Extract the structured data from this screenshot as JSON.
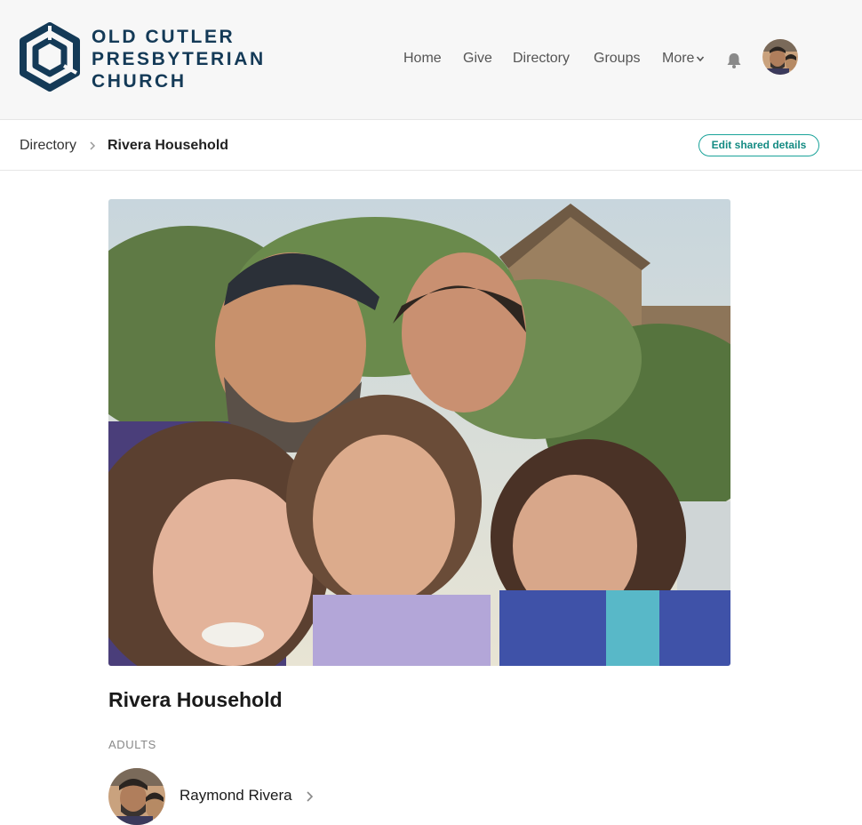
{
  "brand": {
    "line1": "OLD CUTLER",
    "line2": "PRESBYTERIAN",
    "line3": "CHURCH",
    "color": "#143a57"
  },
  "nav": {
    "items": [
      "Home",
      "Give",
      "Directory",
      "Groups",
      "More"
    ]
  },
  "breadcrumb": {
    "root": "Directory",
    "current": "Rivera Household"
  },
  "actions": {
    "edit_label": "Edit shared details",
    "accent": "#1aa39a"
  },
  "household": {
    "title": "Rivera Household",
    "adults_label": "ADULTS",
    "adults": [
      {
        "name": "Raymond Rivera"
      }
    ]
  },
  "icons": {
    "logo": "church-logo-icon",
    "notifications": "bell-icon",
    "chevron": "chevron-right-icon",
    "dropdown": "chevron-down-icon"
  }
}
